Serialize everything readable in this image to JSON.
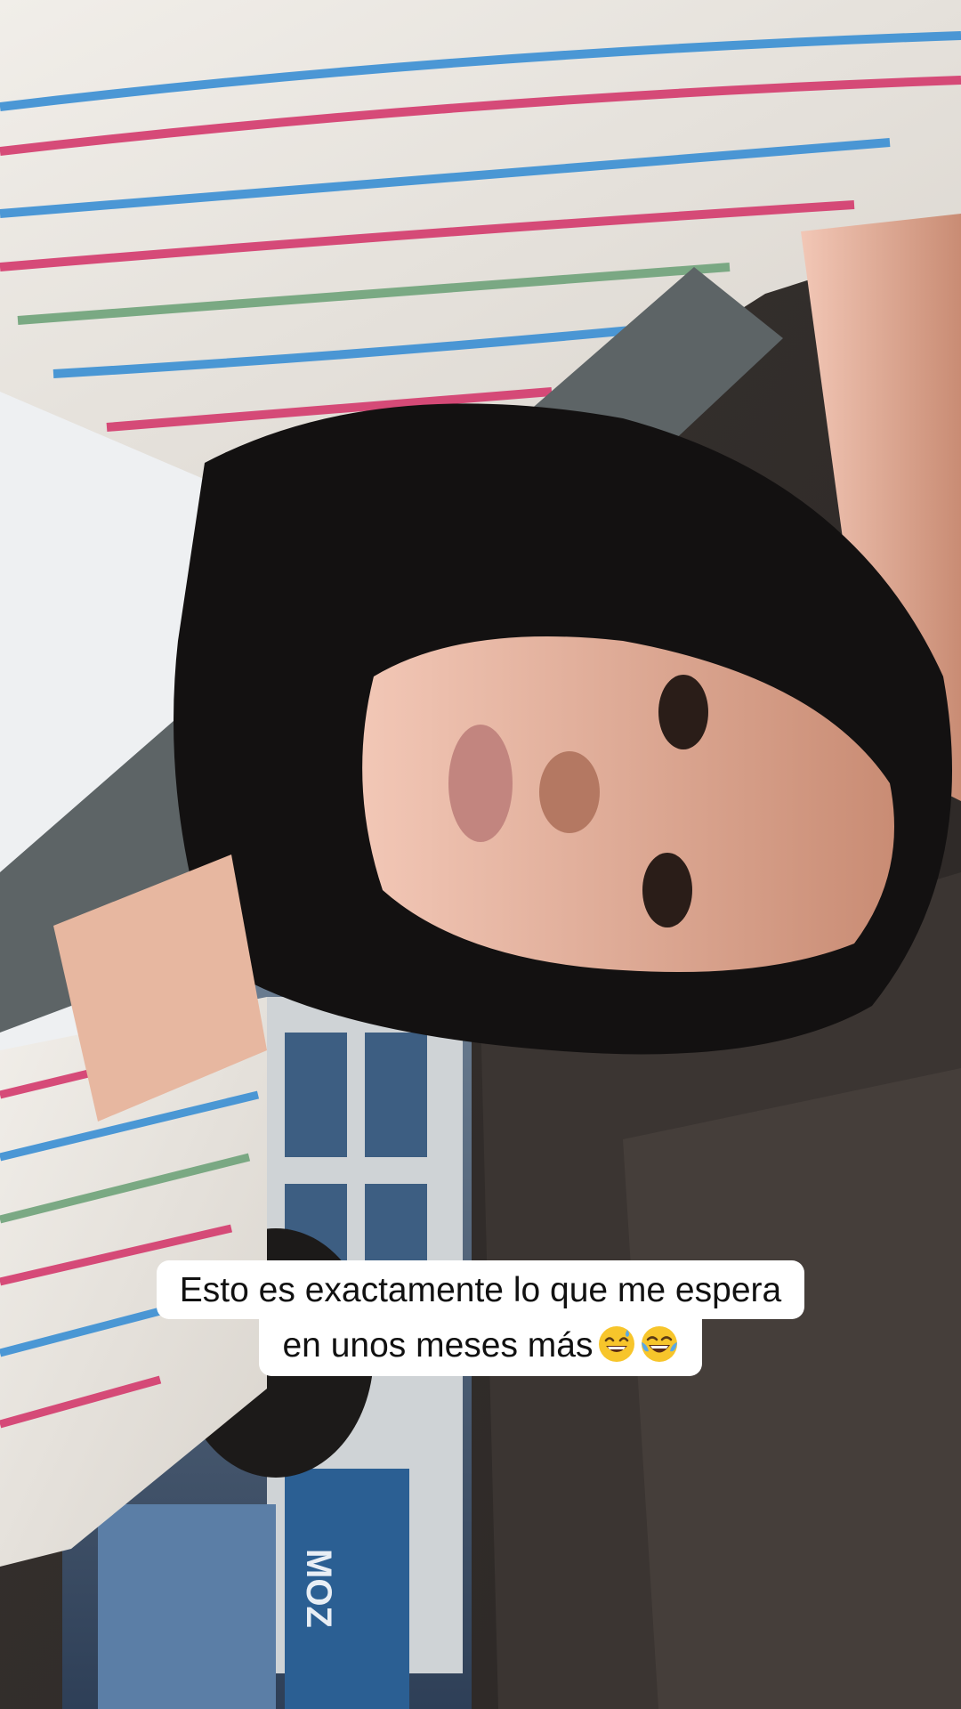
{
  "caption": {
    "line1": "Esto es exactamente lo que me espera",
    "line2": "en unos meses más"
  },
  "icons": {
    "emoji1": "grinning-face-with-sweat-icon",
    "emoji2": "face-with-tears-of-joy-icon"
  },
  "colors": {
    "caption_bg": "#ffffff",
    "caption_text": "#111111"
  },
  "background_sign_text": "MOZ"
}
